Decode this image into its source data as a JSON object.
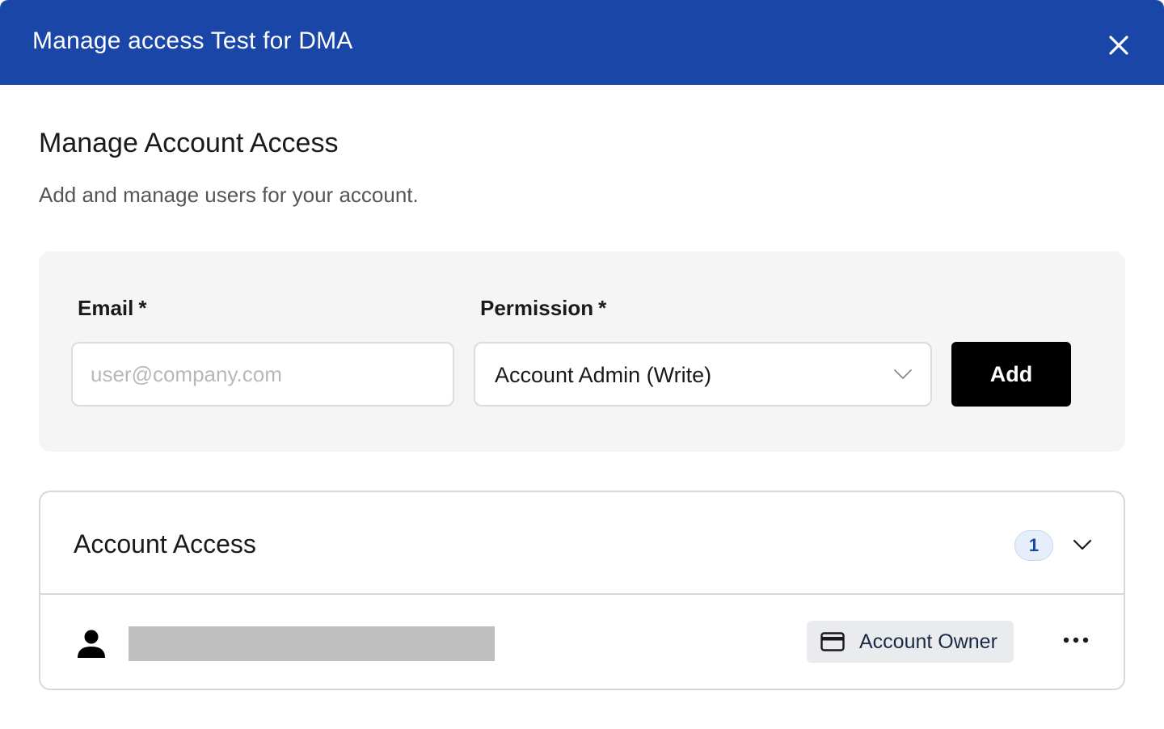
{
  "modal": {
    "title": "Manage access Test for DMA",
    "close_icon": "close-icon",
    "header_color": "#1a46a8"
  },
  "section": {
    "title": "Manage Account Access",
    "subtitle": "Add and manage users for your account."
  },
  "form": {
    "email_label": "Email",
    "email_required": "*",
    "email_value": "",
    "email_placeholder": "user@company.com",
    "permission_label": "Permission",
    "permission_required": "*",
    "permission_selected": "Account Admin (Write)",
    "permission_icon": "chevron-down-icon",
    "add_label": "Add"
  },
  "access": {
    "title": "Account Access",
    "count": "1",
    "collapse_icon": "chevron-down-icon",
    "users": [
      {
        "avatar_icon": "person-icon",
        "name_redacted": true,
        "role_icon": "credit-card-icon",
        "role": "Account Owner",
        "more_icon": "more-horizontal-icon"
      }
    ]
  }
}
